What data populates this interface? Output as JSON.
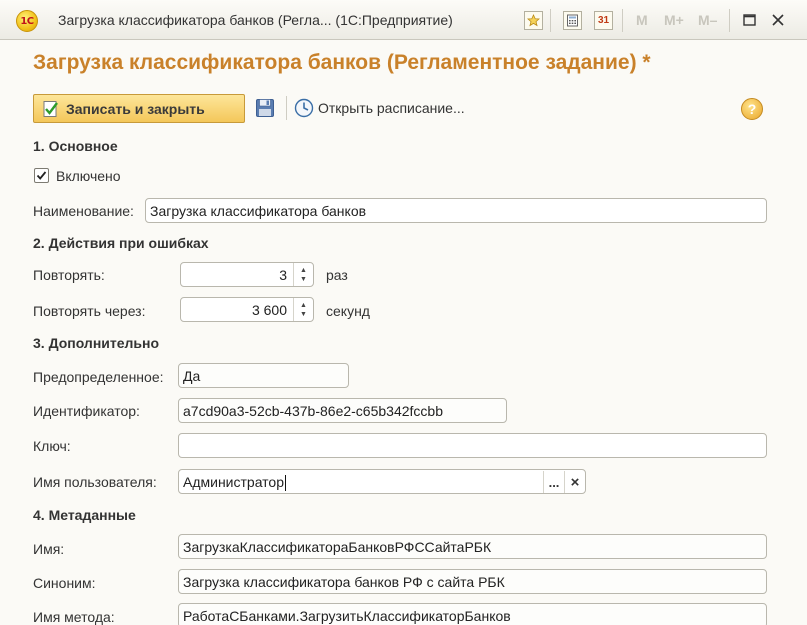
{
  "window": {
    "title": "Загрузка классификатора банков (Регла...  (1С:Предприятие)",
    "logo_text": "1С",
    "mem_buttons": [
      "M",
      "M+",
      "M–"
    ],
    "calendar_day": "31"
  },
  "form": {
    "title": "Загрузка классификатора банков (Регламентное задание) *",
    "save_close_label": "Записать и закрыть",
    "schedule_label": "Открыть расписание...",
    "help_symbol": "?"
  },
  "sections": {
    "main": "1. Основное",
    "errors": "2. Действия при ошибках",
    "extra": "3. Дополнительно",
    "meta": "4. Метаданные"
  },
  "fields": {
    "enabled": {
      "label": "Включено",
      "checked": true
    },
    "name": {
      "label": "Наименование:",
      "value": "Загрузка классификатора банков"
    },
    "repeat": {
      "label": "Повторять:",
      "value": "3",
      "unit": "раз"
    },
    "repeat_after": {
      "label": "Повторять через:",
      "value": "3 600",
      "unit": "секунд"
    },
    "predefined": {
      "label": "Предопределенное:",
      "value": "Да"
    },
    "identifier": {
      "label": "Идентификатор:",
      "value": "a7cd90a3-52cb-437b-86e2-c65b342fccbb"
    },
    "key": {
      "label": "Ключ:",
      "value": ""
    },
    "user": {
      "label": "Имя пользователя:",
      "value": "Администратор",
      "choose": "...",
      "clear": "×"
    },
    "meta_name": {
      "label": "Имя:",
      "value": "ЗагрузкаКлассификатораБанковРФССайтаРБК"
    },
    "synonym": {
      "label": "Синоним:",
      "value": "Загрузка классификатора банков РФ с сайта РБК"
    },
    "method": {
      "label": "Имя метода:",
      "value": "РаботаСБанками.ЗагрузитьКлассификаторБанков"
    }
  },
  "colors": {
    "form_title": "#c9812a",
    "button_face": "#f4c75a"
  }
}
